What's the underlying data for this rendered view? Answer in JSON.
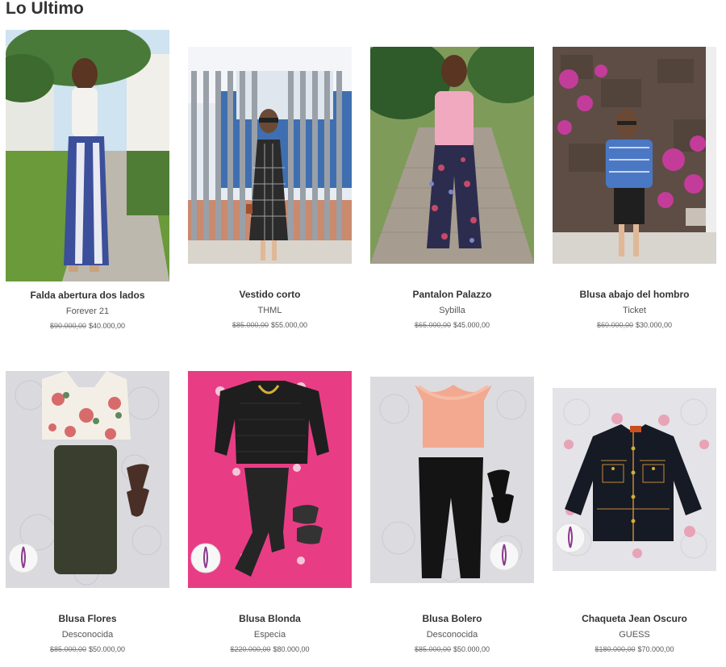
{
  "section": {
    "title": "Lo Ultimo"
  },
  "products": [
    {
      "name": "Falda abertura dos lados",
      "brand": "Forever 21",
      "old_price": "$90.000,00",
      "price": "$40.000,00"
    },
    {
      "name": "Vestido corto",
      "brand": "THML",
      "old_price": "$85.000,00",
      "price": "$55.000,00"
    },
    {
      "name": "Pantalon Palazzo",
      "brand": "Sybilla",
      "old_price": "$65.000,00",
      "price": "$45.000,00"
    },
    {
      "name": "Blusa abajo del hombro",
      "brand": "Ticket",
      "old_price": "$60.000,00",
      "price": "$30.000,00"
    },
    {
      "name": "Blusa Flores",
      "brand": "Desconocida",
      "old_price": "$85.000,00",
      "price": "$50.000,00"
    },
    {
      "name": "Blusa Blonda",
      "brand": "Especia",
      "old_price": "$220.000,00",
      "price": "$80.000,00"
    },
    {
      "name": "Blusa Bolero",
      "brand": "Desconocida",
      "old_price": "$85.000,00",
      "price": "$50.000,00"
    },
    {
      "name": "Chaqueta Jean Oscuro",
      "brand": "GUESS",
      "old_price": "$180.000,00",
      "price": "$70.000,00"
    }
  ],
  "colors": {
    "title": "#333333",
    "old_price": "#777777",
    "pink_backdrop": "#e83d84"
  }
}
